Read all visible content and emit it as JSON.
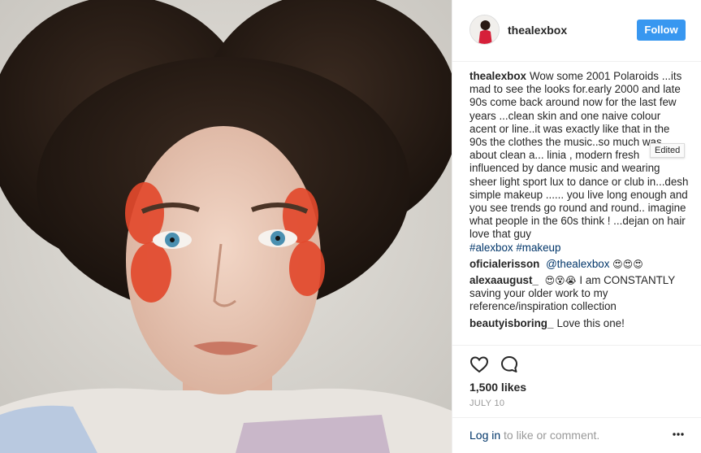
{
  "post": {
    "author": "thealexbox",
    "follow_label": "Follow",
    "edited_tooltip": "Edited",
    "caption": {
      "user": "thealexbox",
      "text": "Wow some 2001 Polaroids ...its mad to see the looks for.early 2000 and late 90s come back around now for the last few years ...clean skin and one naive colour acent or line..it was exactly like that in the 90s the clothes the music..so much was about clean a... linia , modern fresh influenced by dance music and wearing sheer light sport lux to dance or club in...desh simple makeup ...... you live long enough and you see trends go round and round.. imagine what people in the 60s think ! ...dejan on hair love that guy",
      "hashtag1": "#alexbox",
      "hashtag2": "#makeup"
    },
    "comments": [
      {
        "user": "oficialerisson",
        "mention": "@thealexbox",
        "emoji": "😍😍😍"
      },
      {
        "user": "alexaaugust_",
        "emoji": "😍😵😭",
        "text": "I am CONSTANTLY saving your older work to my reference/inspiration collection"
      },
      {
        "user": "beautyisboring_",
        "text": "Love this one!"
      }
    ],
    "likes": "1,500 likes",
    "date": "JULY 10",
    "footer": {
      "login_link": "Log in",
      "login_rest": " to like or comment."
    }
  },
  "icons": {
    "like": "heart-icon",
    "comment": "comment-icon",
    "more": "more-options-icon"
  },
  "colors": {
    "follow_button": "#3897f0",
    "link": "#003569",
    "muted": "#999999"
  }
}
